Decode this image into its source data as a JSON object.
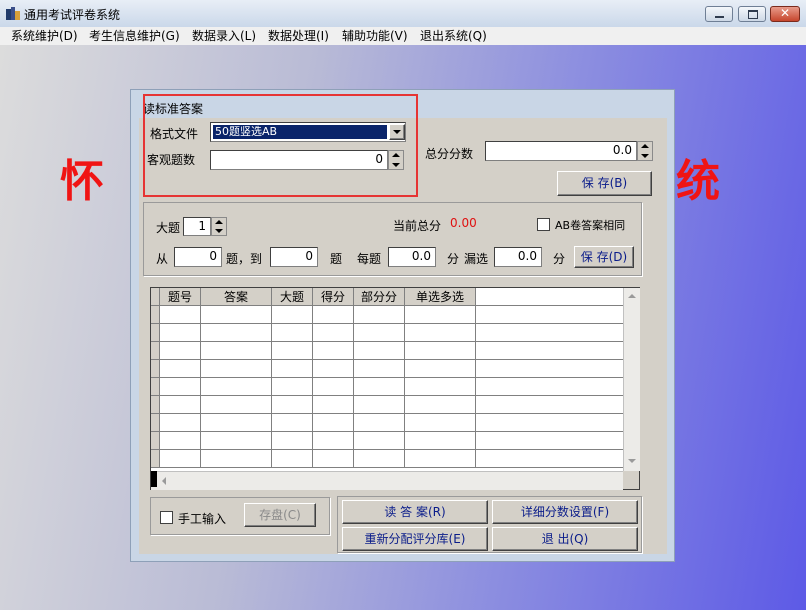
{
  "window": {
    "title": "通用考试评卷系统"
  },
  "menu": [
    "系统维护(D)",
    "考生信息维护(G)",
    "数据录入(L)",
    "数据处理(I)",
    "辅助功能(V)",
    "退出系统(Q)"
  ],
  "background": {
    "left_text": "怀",
    "right_text": "统"
  },
  "dialog": {
    "title": "读标准答案",
    "format_file_label": "格式文件",
    "format_file_value": "50题竖选AB",
    "objective_count_label": "客观题数",
    "objective_count_value": "0",
    "total_score_label": "总分分数",
    "total_score_value": "0.0",
    "save_top_label": "保 存(B)",
    "big_question_label": "大题",
    "big_question_value": "1",
    "current_total_label": "当前总分",
    "current_total_value": "0.00",
    "ab_same_label": "AB卷答案相同",
    "from_label": "从",
    "from_value": "0",
    "to_label": "题，到",
    "to_value": "0",
    "question_label": "题",
    "each_label": "每题",
    "each_value": "0.0",
    "points_label": "分",
    "missing_label": "漏选",
    "missing_value": "0.0",
    "points_label_2": "分",
    "save_mid_label": "保 存(D)",
    "grid_columns": [
      "题号",
      "答案",
      "大题",
      "得分",
      "部分分",
      "单选多选"
    ],
    "manual_input_label": "手工输入",
    "save_disk_label": "存盘(C)",
    "read_answer_label": "读 答 案(R)",
    "detail_score_label": "详细分数设置(F)",
    "reassign_label": "重新分配评分库(E)",
    "exit_label": "退   出(Q)"
  },
  "colors": {
    "accent_red": "#e63434",
    "current_total": "#e01010",
    "button_text": "#0a1c8a",
    "selection": "#0a246a"
  }
}
